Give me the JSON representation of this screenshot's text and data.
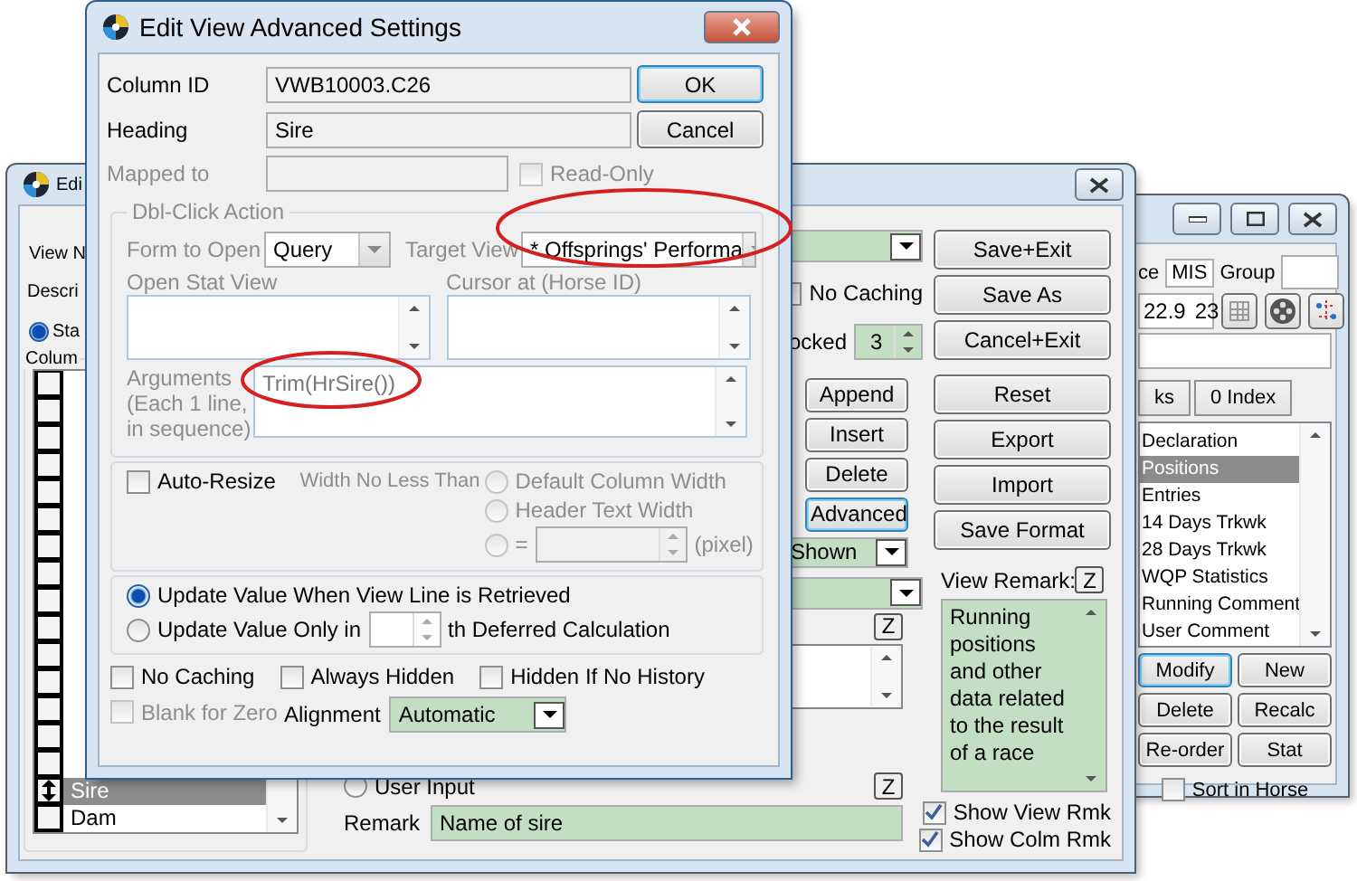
{
  "dialog": {
    "title": "Edit View Advanced Settings",
    "column_id": {
      "label": "Column ID",
      "value": "VWB10003.C26"
    },
    "heading": {
      "label": "Heading",
      "value": "Sire"
    },
    "mapped_to": {
      "label": "Mapped to",
      "disabled": true
    },
    "read_only": {
      "label": "Read-Only",
      "checked": false,
      "disabled": true
    },
    "buttons": [
      {
        "label": "OK",
        "default": true
      },
      {
        "label": "Cancel",
        "default": false
      }
    ],
    "dbl_click_action": {
      "title": "Dbl-Click Action",
      "disabled": true,
      "form_to_open": {
        "label": "Form to Open",
        "value": "Query"
      },
      "target_view": {
        "label": "Target View",
        "value": "* Offsprings' Performa"
      },
      "open_stat_view": {
        "label": "Open Stat View"
      },
      "cursor_at": {
        "label": "Cursor at (Horse ID)"
      },
      "arguments": {
        "label": "Arguments\n(Each 1 line,\nin sequence)",
        "value": "Trim(HrSire())"
      }
    },
    "auto_resize": {
      "label": "Auto-Resize",
      "checked": false
    },
    "min_width": {
      "label": "Width No Less Than",
      "disabled": true,
      "options": [
        {
          "label": "Default Column Width",
          "selected": false
        },
        {
          "label": "Header Text Width",
          "selected": false
        },
        {
          "label": "=",
          "selected": false
        }
      ],
      "unit": "(pixel)"
    },
    "update_mode": {
      "options": [
        {
          "label": "Update Value When View Line is Retrieved",
          "selected": true
        },
        {
          "label": "Update Value Only in",
          "selected": false
        }
      ],
      "suffix": "th Deferred Calculation"
    },
    "flags": [
      {
        "label": "No Caching",
        "checked": false
      },
      {
        "label": "Always Hidden",
        "checked": false
      },
      {
        "label": "Hidden If No History",
        "checked": false
      }
    ],
    "blank_for_zero": {
      "label": "Blank for Zero",
      "checked": false,
      "disabled": true
    },
    "alignment": {
      "label": "Alignment",
      "value": "Automatic"
    }
  },
  "editor_window": {
    "title": "Edi",
    "view_name_label": "View N",
    "description_label": "Descri",
    "standard": {
      "label": "Sta",
      "selected": true
    },
    "columns": {
      "title": "Colum",
      "rows": [
        {
          "name": "Sire",
          "selected": true
        },
        {
          "name": "Dam",
          "selected": false
        }
      ]
    },
    "no_caching": {
      "label": "No Caching",
      "checked": false
    },
    "locked": {
      "label": "ocked",
      "value": "3"
    },
    "column_buttons": [
      {
        "label": "Append",
        "focused": false
      },
      {
        "label": "Insert",
        "focused": false
      },
      {
        "label": "Delete",
        "focused": false
      },
      {
        "label": "Advanced",
        "focused": true
      }
    ],
    "shown": {
      "value": "Shown"
    },
    "formula_zoom": "Z",
    "remark_zoom": "Z",
    "user_input": {
      "label": "User Input",
      "selected": false
    },
    "remark": {
      "label": "Remark",
      "value": "Name of sire"
    },
    "side_buttons": [
      "Save+Exit",
      "Save As",
      "Cancel+Exit",
      "Reset",
      "Export",
      "Import",
      "Save Format"
    ],
    "view_remark": {
      "label": "View Remark:",
      "zoom": "Z",
      "text": "Running positions and other data related to the result of a race"
    },
    "show_view_rmk": {
      "label": "Show View Rmk",
      "checked": true
    },
    "show_colm_rmk": {
      "label": "Show Colm Rmk",
      "checked": true
    }
  },
  "list_window": {
    "source_label": "ce",
    "source_value": "MIS",
    "group_label": "Group",
    "figures": [
      "22.9",
      "23"
    ],
    "tabs": [
      {
        "label": "ks",
        "selected": false
      },
      {
        "label": "0 Index",
        "selected": false
      }
    ],
    "items": [
      {
        "label": "Declaration",
        "selected": false
      },
      {
        "label": "Positions",
        "selected": true
      },
      {
        "label": "Entries",
        "selected": false
      },
      {
        "label": "14 Days Trkwk",
        "selected": false
      },
      {
        "label": "28 Days Trkwk",
        "selected": false
      },
      {
        "label": "WQP Statistics",
        "selected": false
      },
      {
        "label": "Running Comment",
        "selected": false
      },
      {
        "label": "User Comment",
        "selected": false
      }
    ],
    "buttons": [
      {
        "label": "Modify",
        "focused": true
      },
      {
        "label": "New",
        "focused": false
      },
      {
        "label": "Delete",
        "focused": false
      },
      {
        "label": "Recalc",
        "focused": false
      },
      {
        "label": "Re-order",
        "focused": false
      },
      {
        "label": "Stat",
        "focused": false
      }
    ],
    "sort_in_horse": {
      "label": "Sort in Horse",
      "checked": false
    }
  }
}
